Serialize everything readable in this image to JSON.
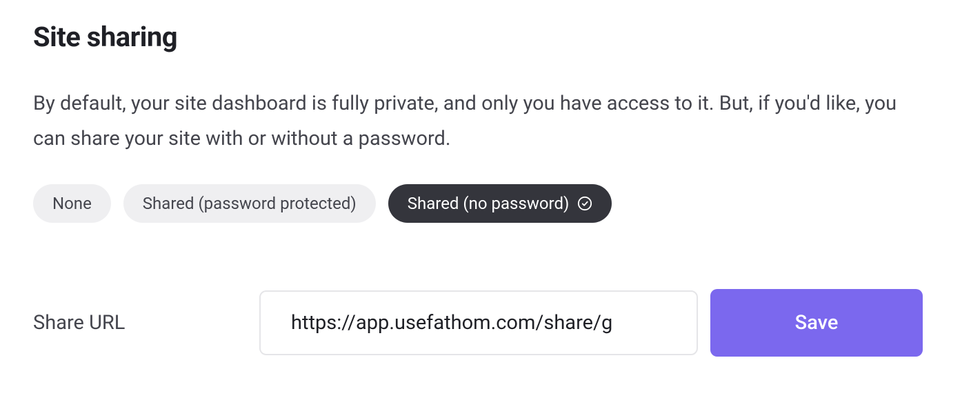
{
  "heading": "Site sharing",
  "description": "By default, your site dashboard is fully private, and only you have access to it. But, if you'd like, you can share your site with or without a password.",
  "options": {
    "none": "None",
    "shared_password": "Shared (password protected)",
    "shared_no_password": "Shared (no password)"
  },
  "selected_option": "shared_no_password",
  "share_url": {
    "label": "Share URL",
    "value": "https://app.usefathom.com/share/g"
  },
  "save_label": "Save",
  "colors": {
    "accent": "#7B68EE",
    "pill_active_bg": "#34353c",
    "pill_inactive_bg": "#efeff1"
  }
}
